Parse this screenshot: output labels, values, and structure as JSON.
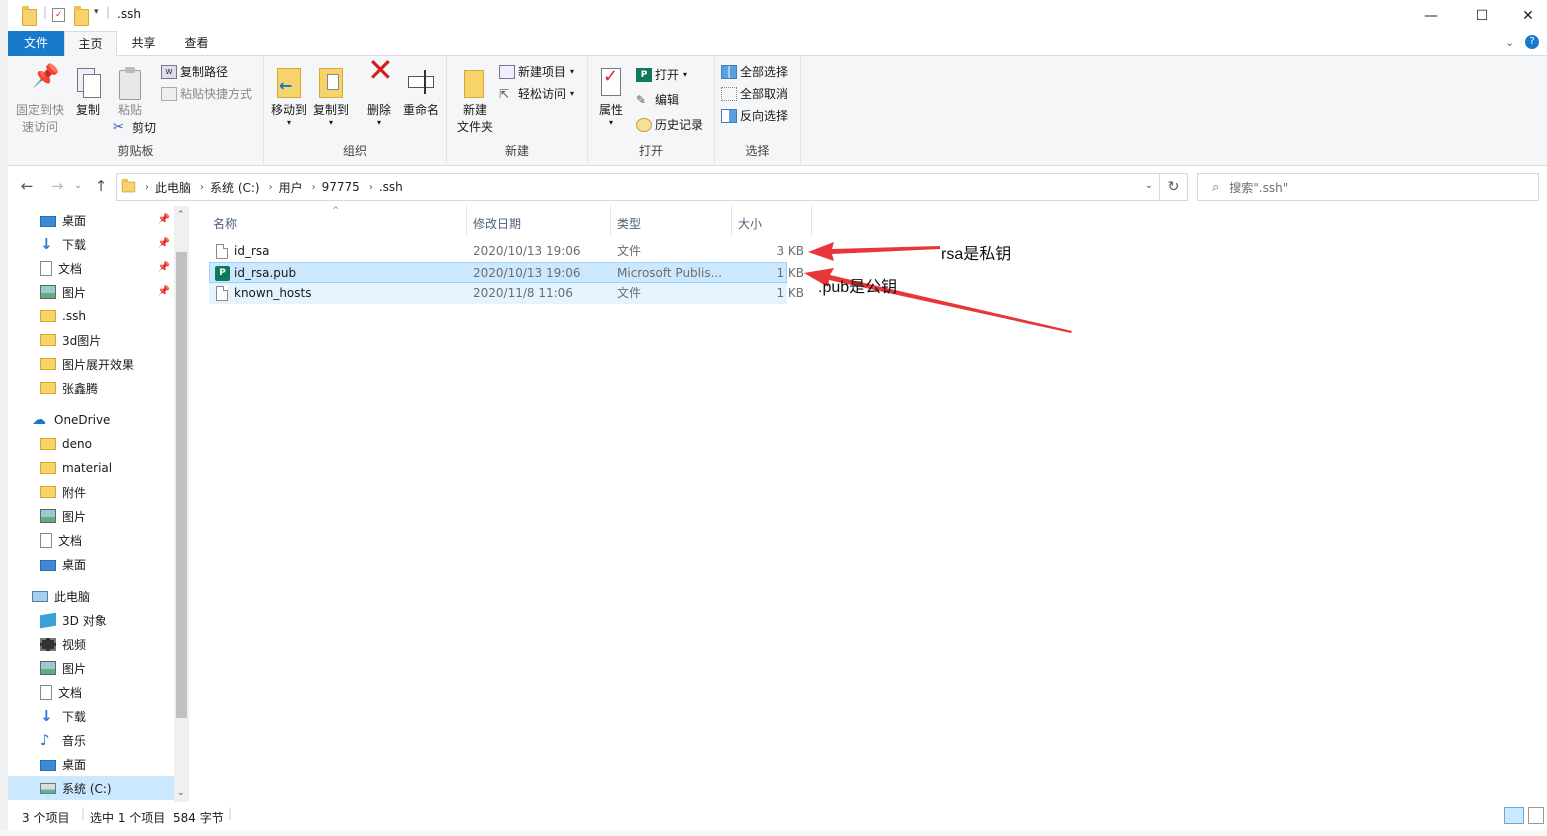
{
  "window": {
    "title": ".ssh",
    "buttons": {
      "minimize": "—",
      "maximize": "☐",
      "close": "✕"
    }
  },
  "ribbon_tabs": [
    "文件",
    "主页",
    "共享",
    "查看"
  ],
  "ribbon": {
    "clipboard": {
      "pin_label": "固定到快\n速访问",
      "pin_l1": "固定到快",
      "pin_l2": "速访问",
      "copy": "复制",
      "paste": "粘贴",
      "copy_path": "复制路径",
      "paste_shortcut": "粘贴快捷方式",
      "cut": "剪切",
      "group": "剪贴板"
    },
    "organize": {
      "move_to": "移动到",
      "copy_to": "复制到",
      "delete": "删除",
      "rename": "重命名",
      "group": "组织"
    },
    "new": {
      "new_folder_l1": "新建",
      "new_folder_l2": "文件夹",
      "new_item": "新建项目",
      "easy_access": "轻松访问",
      "group": "新建"
    },
    "open": {
      "properties": "属性",
      "open": "打开",
      "edit": "编辑",
      "history": "历史记录",
      "group": "打开"
    },
    "select": {
      "select_all": "全部选择",
      "select_none": "全部取消",
      "invert": "反向选择",
      "group": "选择"
    }
  },
  "address": {
    "breadcrumbs": [
      "此电脑",
      "系统 (C:)",
      "用户",
      "97775",
      ".ssh"
    ],
    "search_placeholder": "搜索\".ssh\""
  },
  "nav_pane": {
    "quick_access": [
      {
        "label": "桌面",
        "icon": "desktop-icon",
        "pinned": true
      },
      {
        "label": "下载",
        "icon": "download-icon",
        "pinned": true
      },
      {
        "label": "文档",
        "icon": "document-icon",
        "pinned": true
      },
      {
        "label": "图片",
        "icon": "picture-icon",
        "pinned": true
      },
      {
        "label": ".ssh",
        "icon": "folder-icon"
      },
      {
        "label": "3d图片",
        "icon": "folder-icon"
      },
      {
        "label": "图片展开效果",
        "icon": "folder-icon"
      },
      {
        "label": "张鑫腾",
        "icon": "folder-icon"
      }
    ],
    "onedrive_label": "OneDrive",
    "onedrive": [
      {
        "label": "deno",
        "icon": "folder-icon"
      },
      {
        "label": "material",
        "icon": "folder-icon"
      },
      {
        "label": "附件",
        "icon": "folder-icon"
      },
      {
        "label": "图片",
        "icon": "picture-icon"
      },
      {
        "label": "文档",
        "icon": "document-icon"
      },
      {
        "label": "桌面",
        "icon": "desktop-icon"
      }
    ],
    "this_pc_label": "此电脑",
    "this_pc": [
      {
        "label": "3D 对象",
        "icon": "cube-icon"
      },
      {
        "label": "视频",
        "icon": "video-icon"
      },
      {
        "label": "图片",
        "icon": "picture-icon"
      },
      {
        "label": "文档",
        "icon": "document-icon"
      },
      {
        "label": "下载",
        "icon": "download-icon"
      },
      {
        "label": "音乐",
        "icon": "music-icon"
      },
      {
        "label": "桌面",
        "icon": "desktop-icon"
      },
      {
        "label": "系统 (C:)",
        "icon": "drive-icon",
        "selected": true
      }
    ]
  },
  "file_list": {
    "columns": [
      "名称",
      "修改日期",
      "类型",
      "大小"
    ],
    "rows": [
      {
        "name": "id_rsa",
        "date": "2020/10/13 19:06",
        "type": "文件",
        "size": "3 KB"
      },
      {
        "name": "id_rsa.pub",
        "date": "2020/10/13 19:06",
        "type": "Microsoft Publis...",
        "size": "1 KB"
      },
      {
        "name": "known_hosts",
        "date": "2020/11/8 11:06",
        "type": "文件",
        "size": "1 KB"
      }
    ]
  },
  "annotations": {
    "rsa": "rsa是私钥",
    "pub": ".pub是公钥",
    "arrow_color": "#e8363a"
  },
  "status": {
    "count": "3 个项目",
    "selection": "选中 1 个项目",
    "size": "584 字节"
  },
  "colors": {
    "file_tab": "#1979ca",
    "selection": "#cce8ff",
    "ribbon_bg": "#f5f6f7"
  }
}
